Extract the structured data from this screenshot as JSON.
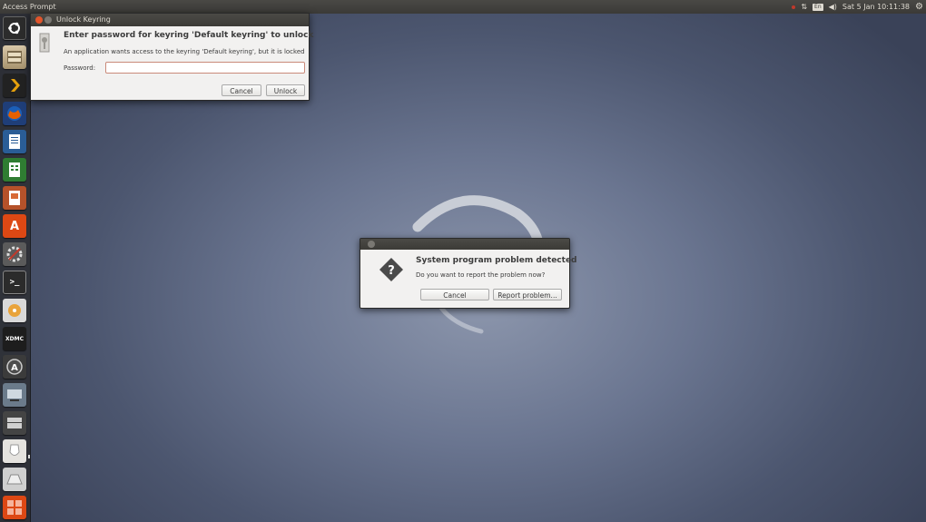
{
  "panel": {
    "title": "Access Prompt",
    "keyboard_indicator": "En",
    "clock": "Sat 5 Jan 10:11:38"
  },
  "launcher": {
    "items": [
      {
        "name": "dash-home",
        "icon": "ubuntu-logo-icon"
      },
      {
        "name": "files",
        "icon": "file-cabinet-icon"
      },
      {
        "name": "plex",
        "icon": "plex-chevron-icon"
      },
      {
        "name": "firefox",
        "icon": "firefox-icon"
      },
      {
        "name": "libreoffice-writer",
        "icon": "writer-icon"
      },
      {
        "name": "libreoffice-calc",
        "icon": "calc-icon"
      },
      {
        "name": "libreoffice-impress",
        "icon": "impress-icon"
      },
      {
        "name": "software-center",
        "icon": "software-center-icon"
      },
      {
        "name": "system-settings",
        "icon": "settings-icon"
      },
      {
        "name": "terminal",
        "icon": "terminal-icon"
      },
      {
        "name": "disk-utility",
        "icon": "disk-icon"
      },
      {
        "name": "xdmc",
        "icon": "xdmc-icon",
        "label": "XDMC"
      },
      {
        "name": "software-updater",
        "icon": "updater-icon"
      },
      {
        "name": "remote-desktop",
        "icon": "remote-desktop-icon"
      },
      {
        "name": "mounted-drive",
        "icon": "drive-icon"
      },
      {
        "name": "keyring-app",
        "icon": "keyring-app-icon"
      },
      {
        "name": "removable-drive",
        "icon": "removable-drive-icon"
      },
      {
        "name": "workspaces",
        "icon": "workspaces-icon"
      }
    ]
  },
  "keyring_dialog": {
    "window_title": "Unlock Keyring",
    "heading": "Enter password for keyring 'Default keyring' to unlock",
    "message": "An application wants access to the keyring 'Default keyring', but it is locked",
    "password_label": "Password:",
    "password_value": "",
    "cancel_label": "Cancel",
    "unlock_label": "Unlock"
  },
  "problem_dialog": {
    "heading": "System program problem detected",
    "message": "Do you want to report the problem now?",
    "cancel_label": "Cancel",
    "report_label": "Report problem..."
  },
  "colors": {
    "accent_orange": "#dd4814",
    "close_button": "#e2552b",
    "dialog_bg": "#f2f1f0",
    "panel_bg": "#3c3b37"
  }
}
